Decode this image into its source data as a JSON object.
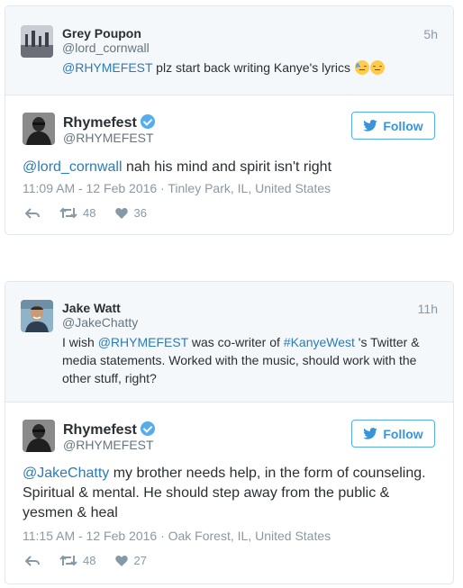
{
  "tweets": [
    {
      "parent": {
        "name": "Grey Poupon",
        "handle": "@lord_cornwall",
        "time": "5h",
        "mention": "@RHYMEFEST",
        "text_after": " plz start back writing Kanye's lyrics",
        "emojis": [
          "disappointed-relieved-emoji",
          "relieved-emoji"
        ]
      },
      "main": {
        "name": "Rhymefest",
        "handle": "@RHYMEFEST",
        "follow_label": "Follow",
        "mention": "@lord_cornwall",
        "text_after": " nah his mind and spirit isn't right",
        "meta": "11:09 AM - 12 Feb 2016 · Tinley Park, IL, United States",
        "retweets": "48",
        "likes": "36"
      }
    },
    {
      "parent": {
        "name": "Jake Watt",
        "handle": "@JakeChatty",
        "time": "11h",
        "text_1": "I wish ",
        "mention": "@RHYMEFEST",
        "text_2": " was co-writer of ",
        "hashtag": "#KanyeWest",
        "text_3": " 's Twitter & media statements. Worked with the music, should work with the other stuff, right?"
      },
      "main": {
        "name": "Rhymefest",
        "handle": "@RHYMEFEST",
        "follow_label": "Follow",
        "mention": "@JakeChatty",
        "text_after": " my brother needs help, in the form of counseling. Spiritual & mental. He should step away from the public & yesmen & heal",
        "meta": "11:15 AM - 12 Feb 2016 · Oak Forest, IL, United States",
        "retweets": "48",
        "likes": "27"
      }
    }
  ],
  "colors": {
    "link": "#2b7bb9",
    "follow": "#3b94d9",
    "verified": "#55acee",
    "muted": "#8899a6",
    "parent_bg": "#f5f8fa"
  }
}
